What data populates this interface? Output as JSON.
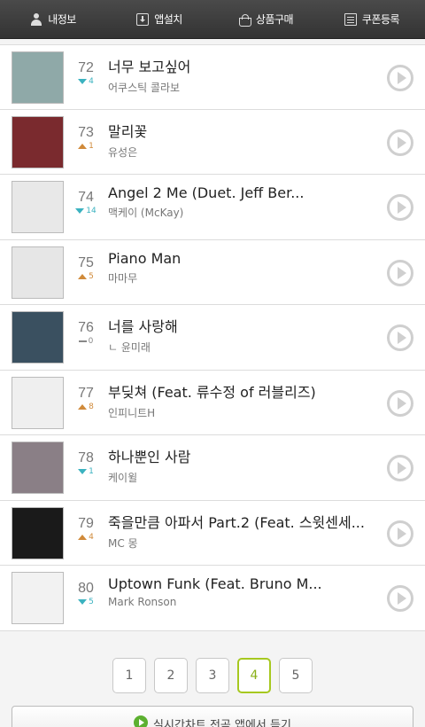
{
  "nav": [
    {
      "label": "내정보",
      "icon": "user-icon"
    },
    {
      "label": "앱설치",
      "icon": "install-icon"
    },
    {
      "label": "상품구매",
      "icon": "basket-icon"
    },
    {
      "label": "쿠폰등록",
      "icon": "coupon-icon"
    }
  ],
  "songs": [
    {
      "rank": "72",
      "dir": "down",
      "change": "4",
      "title": "너무 보고싶어",
      "artist": "어쿠스틱 콜라보",
      "thumb": "#8fa9a8"
    },
    {
      "rank": "73",
      "dir": "up",
      "change": "1",
      "title": "말리꽃",
      "artist": "유성은",
      "thumb": "#7a2a2e"
    },
    {
      "rank": "74",
      "dir": "down",
      "change": "14",
      "title": "Angel 2 Me (Duet. Jeff Ber...",
      "artist": "맥케이 (McKay)",
      "thumb": "#e8e8e8"
    },
    {
      "rank": "75",
      "dir": "up",
      "change": "5",
      "title": "Piano Man",
      "artist": "마마무",
      "thumb": "#e6e6e6"
    },
    {
      "rank": "76",
      "dir": "same",
      "change": "0",
      "title": "너를 사랑해",
      "artist": "ㄴ 윤미래",
      "thumb": "#3a5060"
    },
    {
      "rank": "77",
      "dir": "up",
      "change": "8",
      "title": "부딪쳐 (Feat. 류수정 of 러블리즈)",
      "artist": "인피니트H",
      "thumb": "#efefef"
    },
    {
      "rank": "78",
      "dir": "down",
      "change": "1",
      "title": "하나뿐인 사람",
      "artist": "케이윌",
      "thumb": "#8a7f86"
    },
    {
      "rank": "79",
      "dir": "up",
      "change": "4",
      "title": "죽을만큼 아파서 Part.2 (Feat. 스윗센세...",
      "artist": "MC 몽",
      "thumb": "#1a1a1a"
    },
    {
      "rank": "80",
      "dir": "down",
      "change": "5",
      "title": "Uptown Funk (Feat. Bruno M...",
      "artist": "Mark Ronson",
      "thumb": "#f2f2f2"
    }
  ],
  "pages": [
    "1",
    "2",
    "3",
    "4",
    "5"
  ],
  "active_page": "4",
  "bottom_button": "실시간차트 전곡 앱에서 듣기"
}
